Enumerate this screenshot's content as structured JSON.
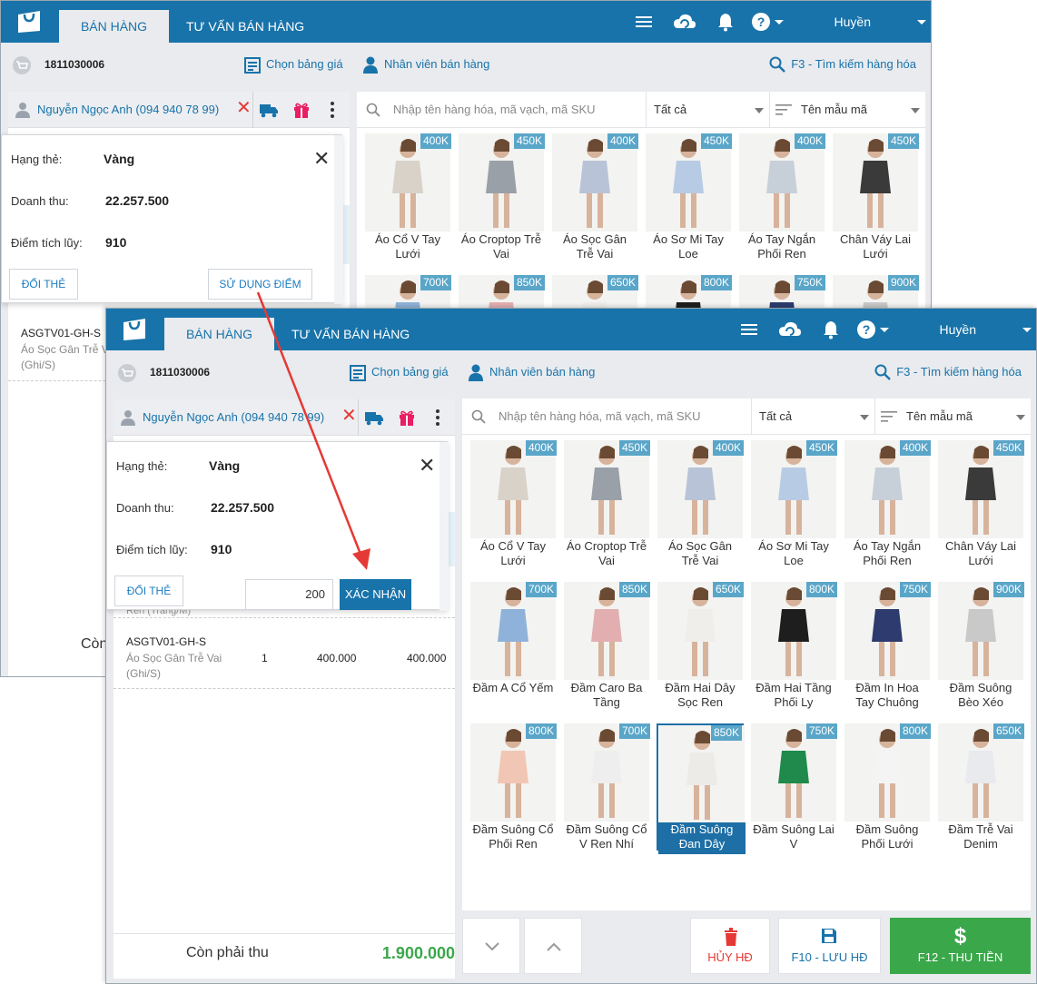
{
  "app": {
    "tabs": [
      "BÁN HÀNG",
      "TƯ VẤN BÁN HÀNG"
    ],
    "user": "Huyền",
    "order_code": "1811030006",
    "price_list_label": "Chọn bảng giá",
    "staff_label": "Nhân viên bán hàng",
    "search_products_label": "F3 - Tìm kiếm hàng hóa"
  },
  "customer": {
    "name": "Nguyễn Ngọc Anh (094 940 78 99)"
  },
  "card_popup": {
    "tier_label": "Hạng thẻ:",
    "tier_value": "Vàng",
    "revenue_label": "Doanh thu:",
    "revenue_value": "22.257.500",
    "points_label": "Điểm tích lũy:",
    "points_value": "910",
    "change_card_label": "ĐỔI THẺ",
    "use_points_label": "SỬ DỤNG ĐIỂM",
    "points_input_value": "200",
    "confirm_label": "XÁC NHẬN"
  },
  "cart": {
    "truncated_text": "Ren (Trắng/M)",
    "item": {
      "sku": "ASGTV01-GH-S",
      "name_line1": "Áo Sọc Gân Trễ Vai",
      "name_line2": "(Ghi/S)",
      "qty": "1",
      "price": "400.000",
      "total": "400.000"
    },
    "partial_total_label": "Còn",
    "total_label": "Còn phải thu",
    "total_value": "1.900.000"
  },
  "search": {
    "placeholder": "Nhập tên hàng hóa, mã vạch, mã SKU",
    "category": "Tất cả",
    "sort": "Tên mẫu mã"
  },
  "products": [
    {
      "name1": "Áo Cổ V Tay",
      "name2": "Lưới",
      "price": "400K",
      "color": "#d9d2c9"
    },
    {
      "name1": "Áo Croptop Trễ",
      "name2": "Vai",
      "price": "450K",
      "color": "#9aa0a8"
    },
    {
      "name1": "Áo Sọc Gân",
      "name2": "Trễ Vai",
      "price": "400K",
      "color": "#b9c3d8"
    },
    {
      "name1": "Áo Sơ Mi Tay",
      "name2": "Loe",
      "price": "450K",
      "color": "#b8cbe4"
    },
    {
      "name1": "Áo Tay Ngắn",
      "name2": "Phối Ren",
      "price": "400K",
      "color": "#c7cfd8"
    },
    {
      "name1": "Chân Váy Lai",
      "name2": "Lưới",
      "price": "450K",
      "color": "#3a3a3a"
    },
    {
      "name1": "Đầm A Cổ Yếm",
      "name2": "",
      "price": "700K",
      "color": "#8fb2da"
    },
    {
      "name1": "Đầm Caro Ba",
      "name2": "Tầng",
      "price": "850K",
      "color": "#e3aeb0"
    },
    {
      "name1": "Đầm Hai Dây",
      "name2": "Sọc Ren",
      "price": "650K",
      "color": "#f0eeeb"
    },
    {
      "name1": "Đầm Hai Tầng",
      "name2": "Phối Ly",
      "price": "800K",
      "color": "#1e1e1e"
    },
    {
      "name1": "Đầm In Hoa",
      "name2": "Tay Chuông",
      "price": "750K",
      "color": "#2d3b6e"
    },
    {
      "name1": "Đầm Suông",
      "name2": "Bèo Xéo",
      "price": "900K",
      "color": "#c9c9c9"
    },
    {
      "name1": "Đầm Suông Cổ",
      "name2": "Phối Ren",
      "price": "800K",
      "color": "#f2c6b4"
    },
    {
      "name1": "Đầm Suông Cổ",
      "name2": "V Ren Nhí",
      "price": "700K",
      "color": "#eeeeee"
    },
    {
      "name1": "Đầm Suông",
      "name2": "Đan Dây",
      "price": "850K",
      "color": "#ecebe8"
    },
    {
      "name1": "Đầm Suông Lai",
      "name2": "V",
      "price": "750K",
      "color": "#1f8a4c"
    },
    {
      "name1": "Đầm Suông",
      "name2": "Phối Lưới",
      "price": "800K",
      "color": "#f4f4f4"
    },
    {
      "name1": "Đầm Trễ Vai",
      "name2": "Denim",
      "price": "650K",
      "color": "#e8eaee"
    }
  ],
  "actions": {
    "cancel_label": "HỦY HĐ",
    "save_label": "F10 - LƯU HĐ",
    "pay_label": "F12 - THU TIỀN"
  },
  "colors": {
    "brand": "#1873aa",
    "pay": "#3aa84a",
    "arrow": "#e53935"
  }
}
